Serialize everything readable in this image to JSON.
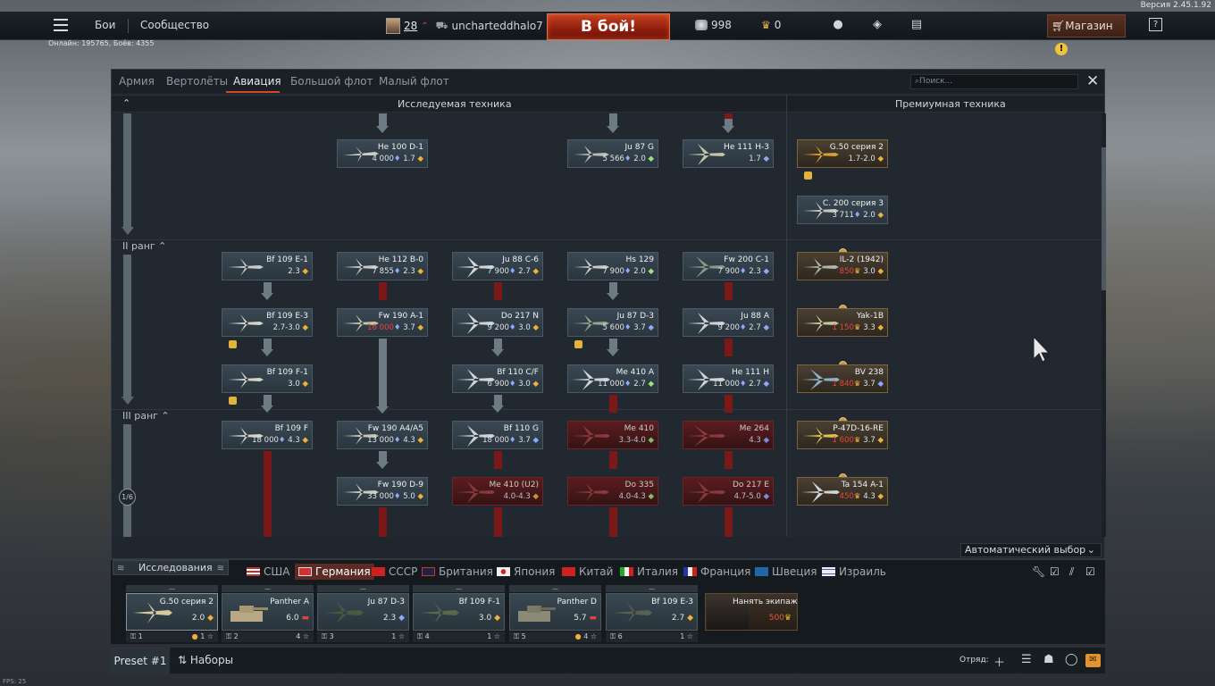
{
  "version": "Версия 2.45.1.92",
  "topbar": {
    "nav": [
      "Бои",
      "Сообщество"
    ],
    "player_level": "28",
    "nickname": "uncharteddhalo7",
    "battle_button": "В бой!",
    "silver": "998",
    "gold": "0",
    "shop": "Магазин",
    "help": "?"
  },
  "online": "Онлайн: 195765, Боёв: 4355",
  "tabs": [
    "Армия",
    "Вертолёты",
    "Авиация",
    "Большой флот",
    "Малый флот"
  ],
  "search_placeholder": "Поиск...",
  "col_headers": {
    "research": "Исследуемая техника",
    "premium": "Премиумная техника"
  },
  "ranks": [
    "II ранг",
    "III ранг"
  ],
  "tier_circle": "1/6",
  "cards": {
    "c1": {
      "name": "He 100 D-1",
      "rp": "4 000",
      "br": "1.7"
    },
    "c2": {
      "name": "Ju 87 G",
      "rp": "5 566",
      "br": "2.0"
    },
    "c3": {
      "name": "He 111 H-3",
      "rp": "",
      "br": "1.7"
    },
    "c4": {
      "name": "G.50 серия 2",
      "rp": "",
      "br": "1.7-2.0"
    },
    "c5": {
      "name": "C. 200 серия 3",
      "rp": "3 711",
      "br": "2.0"
    },
    "r2a": {
      "name": "Bf 109 E-1",
      "rp": "",
      "br": "2.3"
    },
    "r2b": {
      "name": "He 112 B-0",
      "rp": "7 855",
      "br": "2.3"
    },
    "r2c": {
      "name": "Ju 88 C-6",
      "rp": "7 900",
      "br": "2.7"
    },
    "r2d": {
      "name": "Hs 129",
      "rp": "7 900",
      "br": "2.0"
    },
    "r2e": {
      "name": "Fw 200 C-1",
      "rp": "7 900",
      "br": "2.3"
    },
    "r2f": {
      "name": "IL-2 (1942)",
      "rp": "850",
      "br": "3.0"
    },
    "r2g": {
      "name": "Bf 109 E-3",
      "rp": "",
      "br": "2.7-3.0"
    },
    "r2h": {
      "name": "Fw 190 A-1",
      "rp": "16 000",
      "br": "3.7"
    },
    "r2i": {
      "name": "Do 217 N",
      "rp": "9 200",
      "br": "3.0"
    },
    "r2j": {
      "name": "Ju 87 D-3",
      "rp": "5 600",
      "br": "3.7"
    },
    "r2k": {
      "name": "Ju 88 A",
      "rp": "9 200",
      "br": "2.7"
    },
    "r2l": {
      "name": "Yak-1B",
      "rp": "1 150",
      "br": "3.3"
    },
    "r2m": {
      "name": "Bf 109 F-1",
      "rp": "",
      "br": "3.0"
    },
    "r2n": {
      "name": "Bf 110 C/F",
      "rp": "6 900",
      "br": "3.0"
    },
    "r2o": {
      "name": "Me 410 A",
      "rp": "11 000",
      "br": "2.7"
    },
    "r2p": {
      "name": "He 111 H",
      "rp": "11 000",
      "br": "2.7"
    },
    "r2q": {
      "name": "BV 238",
      "rp": "1 840",
      "br": "3.7"
    },
    "r3a": {
      "name": "Bf 109 F",
      "rp": "18 000",
      "br": "4.3"
    },
    "r3b": {
      "name": "Fw 190 A4/A5",
      "rp": "13 000",
      "br": "4.3"
    },
    "r3c": {
      "name": "Bf 110 G",
      "rp": "18 000",
      "br": "3.7"
    },
    "r3d": {
      "name": "Me 410",
      "rp": "",
      "br": "3.3-4.0"
    },
    "r3e": {
      "name": "Me 264",
      "rp": "",
      "br": "4.3"
    },
    "r3f": {
      "name": "P-47D-16-RE",
      "rp": "1 600",
      "br": "3.7"
    },
    "r3g": {
      "name": "Fw 190 D-9",
      "rp": "33 000",
      "br": "5.0"
    },
    "r3h": {
      "name": "Me 410 (U2)",
      "rp": "",
      "br": "4.0-4.3"
    },
    "r3i": {
      "name": "Do 335",
      "rp": "",
      "br": "4.0-4.3"
    },
    "r3j": {
      "name": "Do 217 E",
      "rp": "",
      "br": "4.7-5.0"
    },
    "r3k": {
      "name": "Ta 154 A-1",
      "rp": "450",
      "br": "4.3"
    }
  },
  "autoselect": "Автоматический выбор",
  "research_tab": "Исследования",
  "nations": [
    "США",
    "Германия",
    "СССР",
    "Британия",
    "Япония",
    "Китай",
    "Италия",
    "Франция",
    "Швеция",
    "Израиль"
  ],
  "crew_slots": [
    {
      "head": "—",
      "name": "G.50 серия 2",
      "br": "2.0",
      "num": "1",
      "crew": "1"
    },
    {
      "head": "—",
      "name": "Panther A",
      "br": "6.0",
      "num": "2",
      "crew": "4"
    },
    {
      "head": "—",
      "name": "Ju 87 D-3",
      "br": "2.3",
      "num": "3",
      "crew": "1"
    },
    {
      "head": "—",
      "name": "Bf 109 F-1",
      "br": "3.0",
      "num": "4",
      "crew": "1"
    },
    {
      "head": "—",
      "name": "Panther D",
      "br": "5.7",
      "num": "5",
      "crew": "4"
    },
    {
      "head": "—",
      "name": "Bf 109 E-3",
      "br": "2.7",
      "num": "6",
      "crew": "1"
    }
  ],
  "hire": {
    "label": "Нанять экипаж",
    "cost": "500"
  },
  "bottombar": {
    "preset": "Preset #1",
    "sets": "Наборы",
    "squad": "Отряд:"
  },
  "fps": "FPS: 25",
  "colors": {
    "accent": "#d7452a",
    "battle": "#a82a14",
    "premium": "#7a6140",
    "locked": "#7b1818"
  }
}
